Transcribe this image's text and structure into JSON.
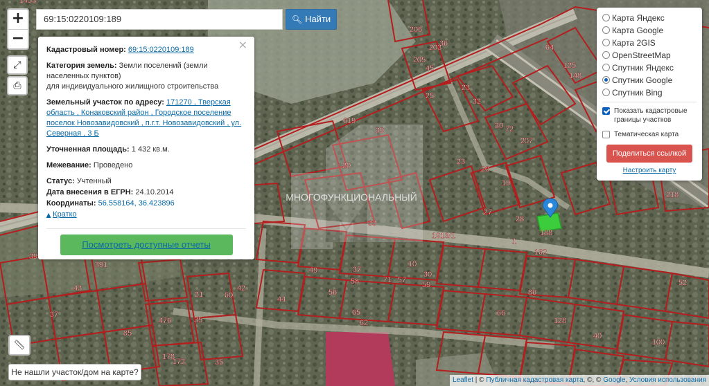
{
  "search": {
    "value": "69:15:0220109:189",
    "button_label": "Найти"
  },
  "zoom": {
    "in": "+",
    "out": "−"
  },
  "info": {
    "cadastral_label": "Кадастровый номер:",
    "cadastral_value": "69:15:0220109:189",
    "category_label": "Категория земель:",
    "category_value": "Земли поселений (земли населенных пунктов)",
    "category_use": "для индивидуального жилищного строительства",
    "address_label": "Земельный участок по адресу:",
    "address_value": "171270 , Тверская область , Конаковский район , Городское поселение поселок Новозавидовский , п.г.т. Новозавидовский , ул. Северная , 3 Б",
    "area_label": "Уточненная площадь:",
    "area_value": "1 432 кв.м.",
    "survey_label": "Межевание:",
    "survey_value": "Проведено",
    "status_label": "Статус:",
    "status_value": "Учтенный",
    "egrn_label": "Дата внесения в ЕГРН:",
    "egrn_value": "24.10.2014",
    "coords_label": "Координаты:",
    "coords_value": "56.558164, 36.423896",
    "collapse_link": "Кратко",
    "reports_button": "Посмотреть доступные отчеты"
  },
  "layers": {
    "options": [
      "Карта Яндекс",
      "Карта Google",
      "Карта 2GIS",
      "OpenStreetMap",
      "Спутник Яндекс",
      "Спутник Google",
      "Спутник Bing"
    ],
    "selected": "Спутник Google",
    "show_cadastral": "Показать кадастровые границы участков",
    "thematic": "Тематическая карта",
    "share_button": "Поделиться ссылкой",
    "configure_link": "Настроить карту"
  },
  "not_found_button": "Не нашли участок/дом на карте?",
  "watermark": "МНОГОФУНКЦИОНАЛЬНЫЙ",
  "attribution": {
    "leaflet": "Leaflet",
    "pkk": "Публичная кадастровая карта",
    "google": "Google",
    "terms": "Условия использования"
  },
  "map_labels": [
    "1453",
    "619",
    "1913/1",
    "188",
    "39",
    "36",
    "206",
    "205",
    "203",
    "45",
    "64",
    "125",
    "148",
    "23",
    "32",
    "25",
    "30",
    "72",
    "207",
    "20",
    "23",
    "19",
    "27",
    "28",
    "1",
    "162",
    "10",
    "30",
    "391",
    "39",
    "43",
    "37",
    "85",
    "476",
    "35",
    "60",
    "62",
    "66",
    "86",
    "100",
    "57",
    "59",
    "49",
    "58",
    "33",
    "35",
    "172",
    "178",
    "21",
    "42",
    "44",
    "56",
    "65",
    "71",
    "20",
    "37",
    "128",
    "40",
    "52",
    "218"
  ],
  "colors": {
    "boundary": "#b41e1e",
    "selected_parcel": "#3ccd3c",
    "marker": "#2a86d8"
  }
}
